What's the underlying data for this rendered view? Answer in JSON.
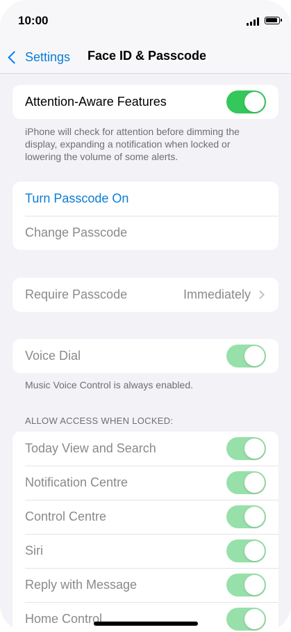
{
  "status_bar": {
    "time": "10:00"
  },
  "nav": {
    "back_label": "Settings",
    "title": "Face ID & Passcode"
  },
  "attention": {
    "label": "Attention-Aware Features",
    "enabled": true,
    "footer": "iPhone will check for attention before dimming the display, expanding a notification when locked or lowering the volume of some alerts."
  },
  "passcode": {
    "turn_on_label": "Turn Passcode On",
    "change_label": "Change Passcode"
  },
  "require": {
    "label": "Require Passcode",
    "value": "Immediately"
  },
  "voice_dial": {
    "label": "Voice Dial",
    "enabled": true,
    "footer": "Music Voice Control is always enabled."
  },
  "locked_access": {
    "header": "ALLOW ACCESS WHEN LOCKED:",
    "items": [
      {
        "label": "Today View and Search",
        "enabled": true
      },
      {
        "label": "Notification Centre",
        "enabled": true
      },
      {
        "label": "Control Centre",
        "enabled": true
      },
      {
        "label": "Siri",
        "enabled": true
      },
      {
        "label": "Reply with Message",
        "enabled": true
      },
      {
        "label": "Home Control",
        "enabled": true
      }
    ]
  },
  "colors": {
    "accent": "#007aff",
    "toggle_on": "#34c759",
    "toggle_disabled": "#98e0a9"
  }
}
